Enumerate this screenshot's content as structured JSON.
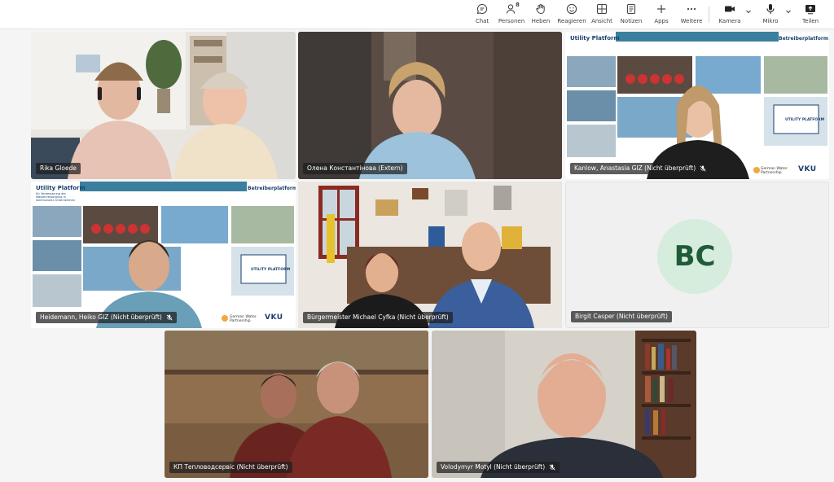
{
  "toolbar": {
    "chat": "Chat",
    "people": "Personen",
    "people_count": "8",
    "raise": "Heben",
    "react": "Reagieren",
    "view": "Ansicht",
    "notes": "Notizen",
    "apps": "Apps",
    "more": "Weitere",
    "camera": "Kamera",
    "mic": "Mikro",
    "share": "Teilen"
  },
  "slide": {
    "title": "Utility Platform",
    "subtitle": "für Verbesserung der Wasserversorgung in kommunalen Unternehmen",
    "badge": "Betreiberplatform",
    "platform_logo": "UTILITY PLATFORM",
    "gwp": "German Water Partnership",
    "vku": "VKU"
  },
  "participants": [
    {
      "name": "Rika Gloede",
      "muted": false
    },
    {
      "name": "Олена Константінова (Extern)",
      "muted": false
    },
    {
      "name": "Kanlow, Anastasia GIZ (Nicht überprüft)",
      "muted": true
    },
    {
      "name": "Heidemann, Heiko GIZ (Nicht überprüft)",
      "muted": true
    },
    {
      "name": "Bürgermeister Michael Cyfka (Nicht überprüft)",
      "muted": false
    },
    {
      "name": "Birgit Casper (Nicht überprüft)",
      "muted": false,
      "initials": "BC"
    },
    {
      "name": "КП Тепловодсервіс (Nicht überprüft)",
      "muted": false
    },
    {
      "name": "Volodymyr Motyl (Nicht überprüft)",
      "muted": true
    }
  ],
  "colors": {
    "accent": "#7f85f5",
    "avatar_bg": "#d6ecdd",
    "avatar_fg": "#1f5b38"
  }
}
